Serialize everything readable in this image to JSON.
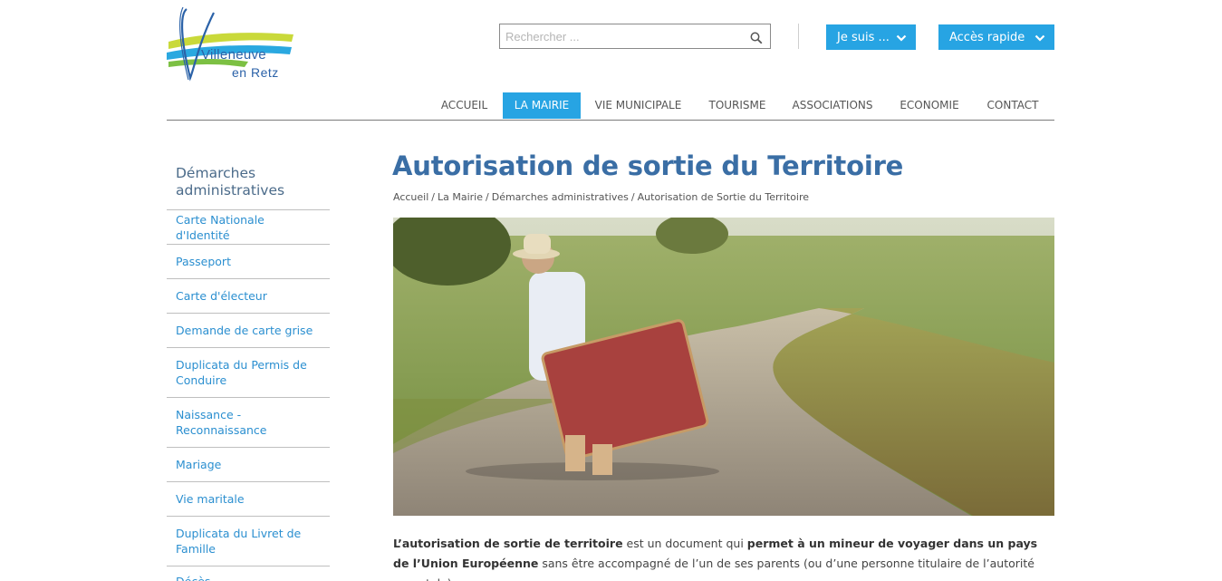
{
  "logo": {
    "line1": "Villeneuve",
    "line2": "en Retz"
  },
  "search": {
    "placeholder": "Rechercher ..."
  },
  "buttons": {
    "je_suis": "Je suis ...",
    "acces_rapide": "Accès rapide"
  },
  "nav": {
    "items": [
      "ACCUEIL",
      "LA MAIRIE",
      "VIE MUNICIPALE",
      "TOURISME",
      "ASSOCIATIONS",
      "ECONOMIE",
      "CONTACT"
    ],
    "active": "LA MAIRIE"
  },
  "sidebar": {
    "title": "Démarches administratives",
    "items": [
      "Carte Nationale d'Identité",
      "Passeport",
      "Carte d'électeur",
      "Demande de carte grise",
      "Duplicata du Permis de Conduire",
      "Naissance - Reconnaissance",
      "Mariage",
      "Vie maritale",
      "Duplicata du Livret de Famille",
      "Décès"
    ]
  },
  "page": {
    "title": "Autorisation de sortie du Territoire",
    "breadcrumb": [
      "Accueil",
      "La Mairie",
      "Démarches administratives",
      "Autorisation de Sortie du Territoire"
    ],
    "breadcrumb_sep": "/",
    "intro": {
      "b1": "L’autorisation de sortie de territoire",
      "t1": " est un document qui ",
      "b2": "permet à un mineur de voyager dans un pays de l’Union Européenne",
      "t2": " sans être accompagné de l’un de ses parents (ou d’une personne titulaire de l’autorité parentale)."
    }
  },
  "colors": {
    "accent": "#27a4e3",
    "title": "#3a6ea5",
    "link": "#2b8fd0"
  }
}
